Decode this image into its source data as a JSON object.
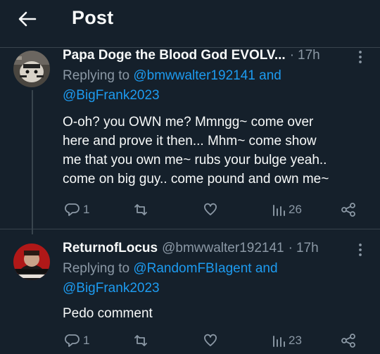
{
  "header": {
    "title": "Post"
  },
  "tweets": [
    {
      "display_name": "Papa Doge the Blood God EVOLV...",
      "separator": "·",
      "time": "17h",
      "replying_prefix": "Replying to",
      "mention_1": "@bmwwalter192141",
      "and_word": "and",
      "mention_2": "@BigFrank2023",
      "body_lines": [
        "O-oh? you OWN me? Mmngg~ come over",
        "here and prove it then... Mhm~ come show",
        "me that you own me~ rubs your bulge yeah..",
        "come on big guy.. come pound and own me~"
      ],
      "replies": "1",
      "retweets": "",
      "likes": "",
      "views": "26"
    },
    {
      "display_name": "ReturnofLocus",
      "handle": "@bmwwalter192141",
      "separator": "·",
      "time": "17h",
      "replying_prefix": "Replying to",
      "mention_1": "@RandomFBIagent",
      "and_word": "and",
      "mention_2": "@BigFrank2023",
      "body_lines": [
        "Pedo comment"
      ],
      "replies": "1",
      "retweets": "",
      "likes": "",
      "views": "23"
    }
  ],
  "colors": {
    "background": "#15202b",
    "link": "#1d9bf0",
    "muted": "#8b98a5",
    "text": "#f7f9f9",
    "divider": "#38444d"
  }
}
